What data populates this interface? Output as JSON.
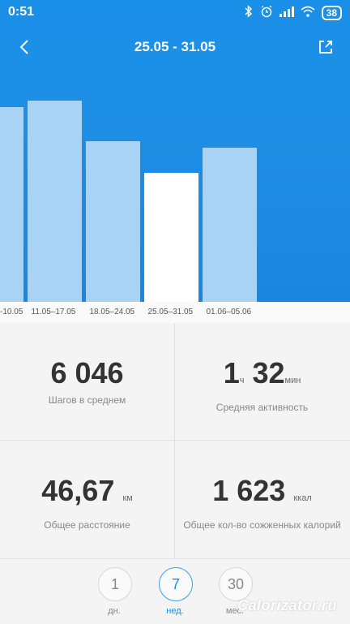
{
  "status": {
    "time": "0:51",
    "battery": "38"
  },
  "header": {
    "title": "25.05 - 31.05"
  },
  "colors": {
    "header_bg": "#1f8fe6",
    "bar": "#a8d3f5",
    "bar_selected": "#ffffff",
    "accent": "#1f8fe6"
  },
  "chart_data": {
    "type": "bar",
    "categories": [
      "-10.05",
      "11.05–17.05",
      "18.05–24.05",
      "25.05–31.05",
      "01.06–05.06"
    ],
    "values": [
      9100,
      9400,
      7500,
      6046,
      7200
    ],
    "selected_index": 3,
    "ylim": [
      0,
      11000
    ]
  },
  "stats": {
    "steps": {
      "value": "6 046",
      "label": "Шагов в среднем"
    },
    "activity": {
      "hours": "1",
      "hours_unit": "ч",
      "minutes": "32",
      "minutes_unit": "мин",
      "label": "Средняя активность"
    },
    "distance": {
      "value": "46,67",
      "unit": "км",
      "label": "Общее расстояние"
    },
    "calories": {
      "value": "1 623",
      "unit": "ккал",
      "label": "Общее кол-во сожженных калорий"
    }
  },
  "periods": [
    {
      "value": "1",
      "label": "дн."
    },
    {
      "value": "7",
      "label": "нед."
    },
    {
      "value": "30",
      "label": "мес."
    }
  ],
  "watermark": "Calorizator.ru"
}
